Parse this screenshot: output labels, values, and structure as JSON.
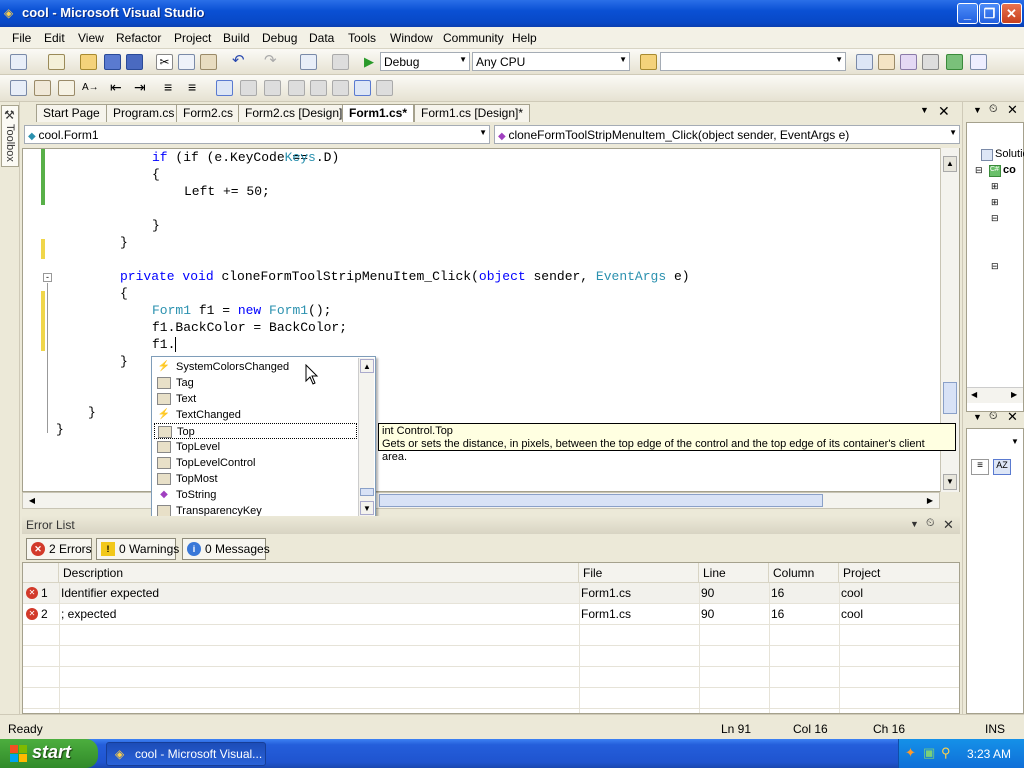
{
  "window": {
    "title": "cool - Microsoft Visual Studio"
  },
  "menu": [
    "File",
    "Edit",
    "View",
    "Refactor",
    "Project",
    "Build",
    "Debug",
    "Data",
    "Tools",
    "Window",
    "Community",
    "Help"
  ],
  "toolbar": {
    "config": "Debug",
    "platform": "Any CPU",
    "find": ""
  },
  "toolbox_label": "Toolbox",
  "tabs": [
    "Start Page",
    "Program.cs",
    "Form2.cs",
    "Form2.cs [Design]",
    "Form1.cs*",
    "Form1.cs [Design]*"
  ],
  "nav": {
    "class": "cool.Form1",
    "member": "cloneFormToolStripMenuItem_Click(object sender, EventArgs e)"
  },
  "code": {
    "l1": {
      "a": "if (e.KeyCode == ",
      "b": "Keys",
      "c": ".D)"
    },
    "l2": "{",
    "l3": "Left += 50;",
    "l4": "}",
    "l5": "}",
    "l6": {
      "kw1": "private",
      "kw2": "void",
      "rest1": " cloneFormToolStripMenuItem_Click(",
      "kw3": "object",
      "rest2": " sender, ",
      "ty": "EventArgs",
      "rest3": " e)"
    },
    "l7": "{",
    "l8": {
      "ty1": "Form1",
      "rest1": " f1 = ",
      "kw": "new",
      "ty2": " Form1",
      "rest2": "();"
    },
    "l9": "f1.BackColor = BackColor;",
    "l10": "f1.",
    "l11": "}",
    "l12": "}",
    "l13": "}"
  },
  "intellisense": {
    "items": [
      {
        "label": "SystemColorsChanged",
        "icon": "event-icon"
      },
      {
        "label": "Tag",
        "icon": "property-icon"
      },
      {
        "label": "Text",
        "icon": "property-icon"
      },
      {
        "label": "TextChanged",
        "icon": "event-icon"
      },
      {
        "label": "Top",
        "icon": "property-icon"
      },
      {
        "label": "TopLevel",
        "icon": "property-icon"
      },
      {
        "label": "TopLevelControl",
        "icon": "property-icon"
      },
      {
        "label": "TopMost",
        "icon": "property-icon"
      },
      {
        "label": "ToString",
        "icon": "method-icon"
      },
      {
        "label": "TransparencyKey",
        "icon": "property-icon"
      }
    ],
    "selected": "Top",
    "tooltip_sig": "int Control.Top",
    "tooltip_desc": "Gets or sets the distance, in pixels, between the top edge of the control and the top edge of its container's client area."
  },
  "errorlist": {
    "title": "Error List",
    "errors_btn": "2 Errors",
    "warnings_btn": "0 Warnings",
    "messages_btn": "0 Messages",
    "columns": [
      "Description",
      "File",
      "Line",
      "Column",
      "Project"
    ],
    "rows": [
      {
        "n": "1",
        "desc": "Identifier expected",
        "file": "Form1.cs",
        "line": "90",
        "col": "16",
        "project": "cool"
      },
      {
        "n": "2",
        "desc": "; expected",
        "file": "Form1.cs",
        "line": "90",
        "col": "16",
        "project": "cool"
      }
    ]
  },
  "solution": {
    "root": "Solutio",
    "project": "co"
  },
  "status": {
    "ready": "Ready",
    "ln": "Ln 91",
    "col": "Col 16",
    "ch": "Ch 16",
    "ins": "INS"
  },
  "taskbar": {
    "start": "start",
    "item": "cool - Microsoft Visual...",
    "clock": "3:23 AM"
  },
  "colors": {
    "titlebar": "#0a50d4",
    "error": "#d23a2a",
    "warning": "#f2c81a",
    "message": "#3a78d8",
    "taskbar": "#245edb",
    "start": "#3c9a32"
  }
}
